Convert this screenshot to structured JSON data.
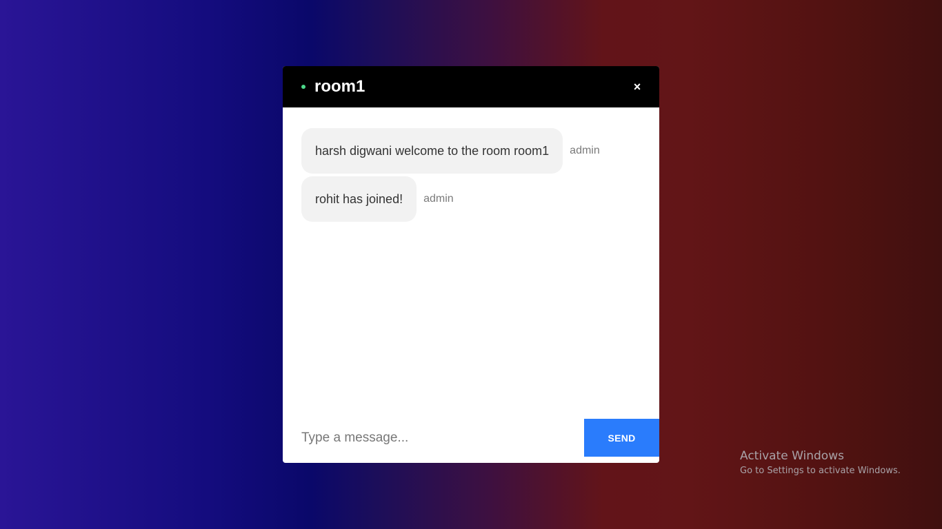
{
  "chat": {
    "room_name": "room1",
    "close_symbol": "×",
    "online_color": "#4cd98a",
    "messages": [
      {
        "text": "harsh digwani welcome to the room room1",
        "sender": "admin"
      },
      {
        "text": "rohit has joined!",
        "sender": "admin"
      }
    ],
    "composer": {
      "placeholder": "Type a message...",
      "value": "",
      "send_label": "SEND"
    }
  },
  "watermark": {
    "title": "Activate Windows",
    "subtitle": "Go to Settings to activate Windows."
  },
  "colors": {
    "send_button": "#2a7cfc",
    "header": "#000000",
    "bubble": "#f2f2f2"
  }
}
